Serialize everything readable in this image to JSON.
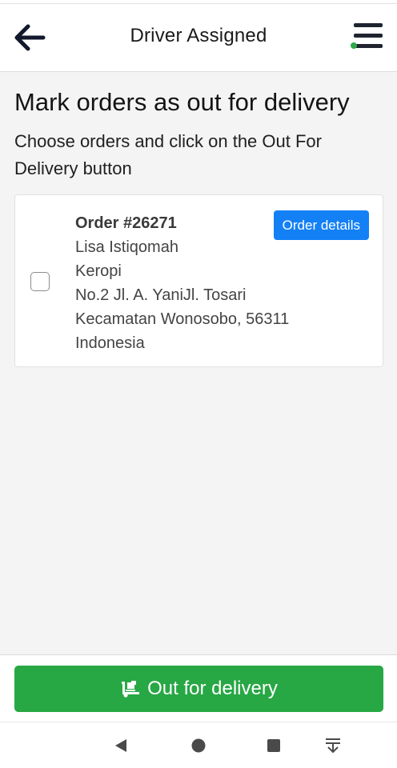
{
  "header": {
    "title": "Driver Assigned",
    "back_icon": "arrow-left-icon",
    "menu_icon": "hamburger-menu-icon",
    "status_dot_color": "#2eaa4a"
  },
  "main": {
    "heading": "Mark orders as out for delivery",
    "subtitle": "Choose orders and click on the Out For Delivery button"
  },
  "orders": [
    {
      "number": "Order #26271",
      "customer": "Lisa Istiqomah",
      "location": "Keropi",
      "street": "No.2 Jl. A. YaniJl. Tosari",
      "city": "Kecamatan Wonosobo, 56311",
      "country": "Indonesia",
      "checked": false,
      "details_label": "Order details"
    }
  ],
  "footer": {
    "delivery_label": "Out for delivery",
    "delivery_icon": "truck-dolly-icon",
    "button_color": "#28a745"
  },
  "system_nav": {
    "back_icon": "nav-back-triangle-icon",
    "home_icon": "nav-home-circle-icon",
    "recents_icon": "nav-recents-square-icon",
    "extra_icon": "nav-pull-down-icon"
  },
  "colors": {
    "accent_blue": "#1480f6",
    "success_green": "#28a745"
  }
}
